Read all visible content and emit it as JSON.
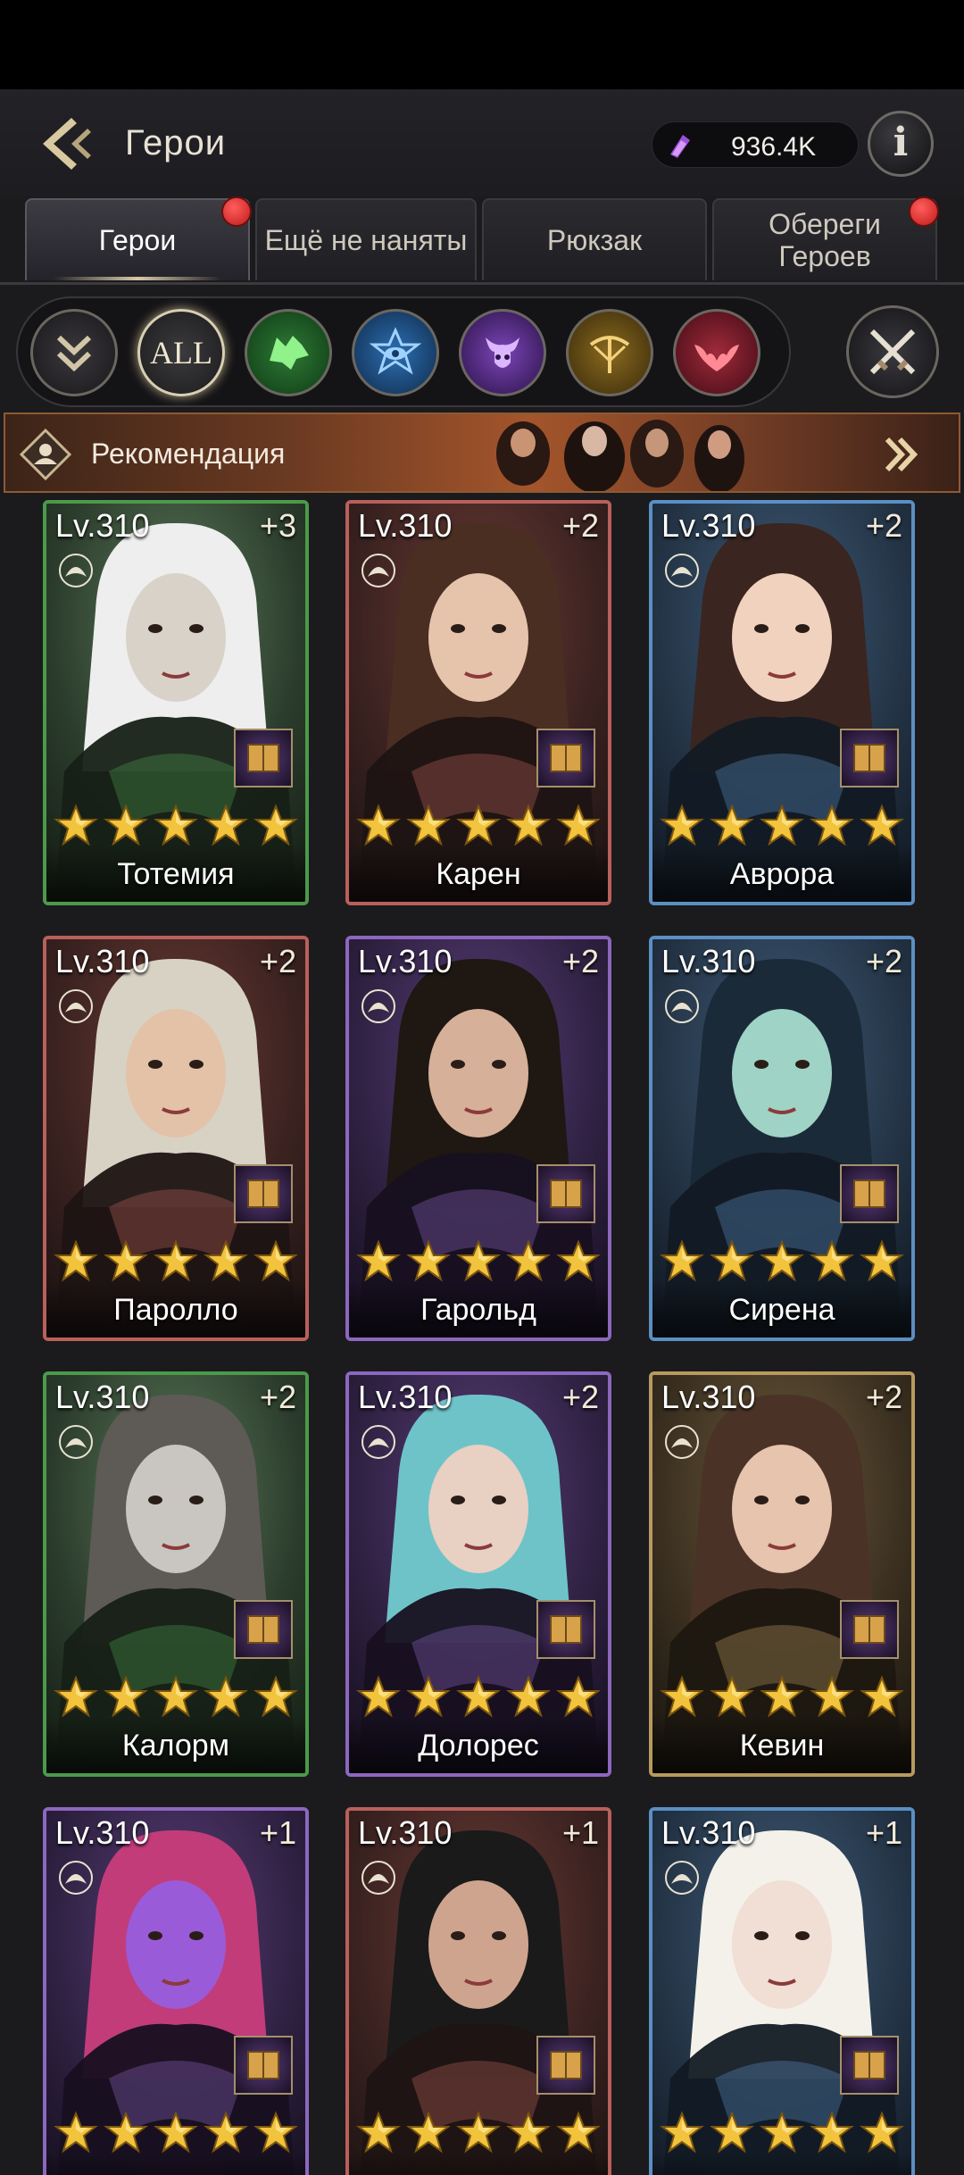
{
  "header": {
    "title": "Герои",
    "currency_value": "936.4K",
    "info_label": "i"
  },
  "tabs": [
    {
      "label": "Герои",
      "active": true,
      "dot": true
    },
    {
      "label": "Ещё не наняты",
      "active": false,
      "dot": false
    },
    {
      "label": "Рюкзак",
      "active": false,
      "dot": false
    },
    {
      "label": "Обереги Героев",
      "active": false,
      "dot": true
    }
  ],
  "filters": {
    "all_label": "ALL"
  },
  "recommend": {
    "label": "Рекомендация"
  },
  "colors": {
    "green": "#4b9a4a",
    "red": "#b9605a",
    "blue": "#5b8fc3",
    "purple": "#8c67bf",
    "gold": "#b79a5e"
  },
  "heroes": [
    {
      "name": "Тотемия",
      "level": "Lv.310",
      "plus": "+3",
      "rarity": "green"
    },
    {
      "name": "Карен",
      "level": "Lv.310",
      "plus": "+2",
      "rarity": "red"
    },
    {
      "name": "Аврора",
      "level": "Lv.310",
      "plus": "+2",
      "rarity": "blue"
    },
    {
      "name": "Паролло",
      "level": "Lv.310",
      "plus": "+2",
      "rarity": "red"
    },
    {
      "name": "Гарольд",
      "level": "Lv.310",
      "plus": "+2",
      "rarity": "purple"
    },
    {
      "name": "Сирена",
      "level": "Lv.310",
      "plus": "+2",
      "rarity": "blue"
    },
    {
      "name": "Калорм",
      "level": "Lv.310",
      "plus": "+2",
      "rarity": "green"
    },
    {
      "name": "Долорес",
      "level": "Lv.310",
      "plus": "+2",
      "rarity": "purple"
    },
    {
      "name": "Кевин",
      "level": "Lv.310",
      "plus": "+2",
      "rarity": "gold"
    },
    {
      "name": "",
      "level": "Lv.310",
      "plus": "+1",
      "rarity": "purple"
    },
    {
      "name": "",
      "level": "Lv.310",
      "plus": "+1",
      "rarity": "red"
    },
    {
      "name": "",
      "level": "Lv.310",
      "plus": "+1",
      "rarity": "blue"
    }
  ]
}
